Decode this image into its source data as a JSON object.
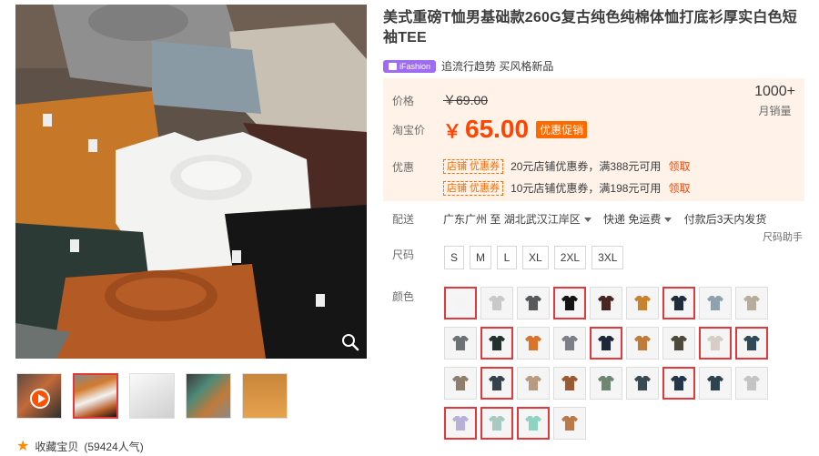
{
  "product": {
    "title": "美式重磅T恤男基础款260G复古纯色纯棉体恤打底衫厚实白色短袖TEE",
    "badge": "iFashion",
    "tagline": "追流行趋势 买风格新品"
  },
  "price": {
    "label": "价格",
    "original": "￥69.00",
    "taobao_label": "淘宝价",
    "currency": "￥",
    "current": "65.00",
    "promo_tag": "优惠促销",
    "sales_count": "1000+",
    "sales_label": "月销量"
  },
  "coupons": {
    "label": "优惠",
    "items": [
      {
        "tag": "店铺  优惠券",
        "text": "20元店铺优惠券，满388元可用",
        "action": "领取"
      },
      {
        "tag": "店铺  优惠券",
        "text": "10元店铺优惠券，满198元可用",
        "action": "领取"
      }
    ]
  },
  "delivery": {
    "label": "配送",
    "origin": "广东广州 至",
    "destination": "湖北武汉江岸区",
    "shipping": "快递 免运费",
    "shipping_time": "付款后3天内发货",
    "size_helper": "尺码助手"
  },
  "sizes": {
    "label": "尺码",
    "options": [
      "S",
      "M",
      "L",
      "XL",
      "2XL",
      "3XL"
    ]
  },
  "colors": {
    "label": "颜色",
    "swatches": [
      {
        "color": "#f4f4f4",
        "selected": true
      },
      {
        "color": "#c9c9c9",
        "selected": false
      },
      {
        "color": "#58595b",
        "selected": false
      },
      {
        "color": "#141414",
        "selected": true
      },
      {
        "color": "#4a2622",
        "selected": false
      },
      {
        "color": "#c9822e",
        "selected": false
      },
      {
        "color": "#1f2c3b",
        "selected": true
      },
      {
        "color": "#8fa1ad",
        "selected": false
      },
      {
        "color": "#b8ad9c",
        "selected": false
      },
      {
        "color": "#6d7274",
        "selected": false
      },
      {
        "color": "#22332e",
        "selected": true
      },
      {
        "color": "#d9752a",
        "selected": false
      },
      {
        "color": "#7d7f88",
        "selected": false
      },
      {
        "color": "#1e2838",
        "selected": true
      },
      {
        "color": "#c07a3a",
        "selected": false
      },
      {
        "color": "#4d4a3c",
        "selected": false
      },
      {
        "color": "#d8cdc6",
        "selected": true
      },
      {
        "color": "#2f4a56",
        "selected": true
      },
      {
        "color": "#8e7f6d",
        "selected": false
      },
      {
        "color": "#37434c",
        "selected": true
      },
      {
        "color": "#b89b80",
        "selected": false
      },
      {
        "color": "#9a5a32",
        "selected": false
      },
      {
        "color": "#6e8672",
        "selected": false
      },
      {
        "color": "#3a4a52",
        "selected": false
      },
      {
        "color": "#22354a",
        "selected": true
      },
      {
        "color": "#2b4450",
        "selected": false
      },
      {
        "color": "#c4c4c4",
        "selected": false
      },
      {
        "color": "#b9b0d8",
        "selected": true
      },
      {
        "color": "#a8c9c2",
        "selected": true
      },
      {
        "color": "#8ed3c2",
        "selected": true
      },
      {
        "color": "#b87a4a",
        "selected": false
      }
    ]
  },
  "gallery": {
    "thumb_colors": [
      "#c36a3a",
      "#d17a2d",
      "#ececec",
      "#4e8a78",
      "#c8863a"
    ]
  },
  "favorite": {
    "text": "收藏宝贝",
    "count": "(59424人气)"
  }
}
